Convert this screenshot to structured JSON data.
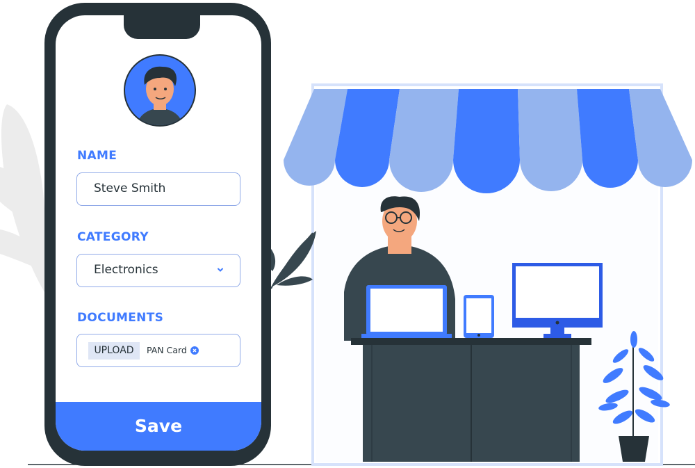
{
  "form": {
    "name_label": "NAME",
    "name_value": "Steve Smith",
    "category_label": "CATEGORY",
    "category_value": "Electronics",
    "documents_label": "DOCUMENTS",
    "upload_label": "UPLOAD",
    "document_name": "PAN Card",
    "save_label": "Save"
  },
  "colors": {
    "accent": "#407bff",
    "accent_light": "#94b4ee",
    "dark": "#263238",
    "counter": "#37474f",
    "skin": "#f4a77e"
  },
  "icons": [
    "user-avatar-icon",
    "chevron-down-icon",
    "close-icon",
    "plant-icon",
    "monitor-icon",
    "laptop-icon",
    "tablet-icon"
  ]
}
